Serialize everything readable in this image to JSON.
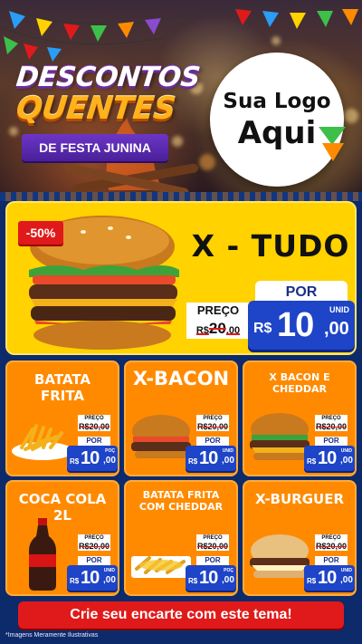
{
  "header": {
    "title_line1": "DESCONTOS",
    "title_line2": "QUENTES",
    "subtitle": "DE FESTA JUNINA",
    "logo_line1": "Sua Logo",
    "logo_line2": "Aqui"
  },
  "featured": {
    "badge": "-50%",
    "name": "X - TUDO",
    "preco_label": "PREÇO",
    "old_price_int": "20",
    "old_price_dec": ",00",
    "old_price_prefix": "R$",
    "por_label": "POR",
    "currency": "R$",
    "price_int": "10",
    "price_dec": ",00",
    "unit": "UNID"
  },
  "items": [
    {
      "name": "BATATA FRITA",
      "preco_label": "PREÇO",
      "old_price": "R$20,00",
      "por_label": "POR",
      "currency": "R$",
      "price_int": "10",
      "price_dec": ",00",
      "unit": "POÇ"
    },
    {
      "name": "X-BACON",
      "preco_label": "PREÇO",
      "old_price": "R$20,00",
      "por_label": "POR",
      "currency": "R$",
      "price_int": "10",
      "price_dec": ",00",
      "unit": "UNID"
    },
    {
      "name": "X BACON E CHEDDAR",
      "preco_label": "PREÇO",
      "old_price": "R$20,00",
      "por_label": "POR",
      "currency": "R$",
      "price_int": "10",
      "price_dec": ",00",
      "unit": "UNID"
    },
    {
      "name": "COCA COLA 2L",
      "preco_label": "PREÇO",
      "old_price": "R$20,00",
      "por_label": "POR",
      "currency": "R$",
      "price_int": "10",
      "price_dec": ",00",
      "unit": "UNID"
    },
    {
      "name": "BATATA FRITA COM CHEDDAR",
      "preco_label": "PREÇO",
      "old_price": "R$20,00",
      "por_label": "POR",
      "currency": "R$",
      "price_int": "10",
      "price_dec": ",00",
      "unit": "POÇ"
    },
    {
      "name": "X-BURGUER",
      "preco_label": "PREÇO",
      "old_price": "R$20,00",
      "por_label": "POR",
      "currency": "R$",
      "price_int": "10",
      "price_dec": ",00",
      "unit": "UNID"
    }
  ],
  "footer": {
    "cta": "Crie seu encarte com este tema!",
    "disclaimer": "*Imagens Meramente Ilustrativas"
  },
  "colors": {
    "background": "#0d2a6b",
    "featured_bg": "#ffd200",
    "item_bg": "#ff8a00",
    "price_bg": "#1e44c7",
    "cta_bg": "#e01a1a"
  }
}
